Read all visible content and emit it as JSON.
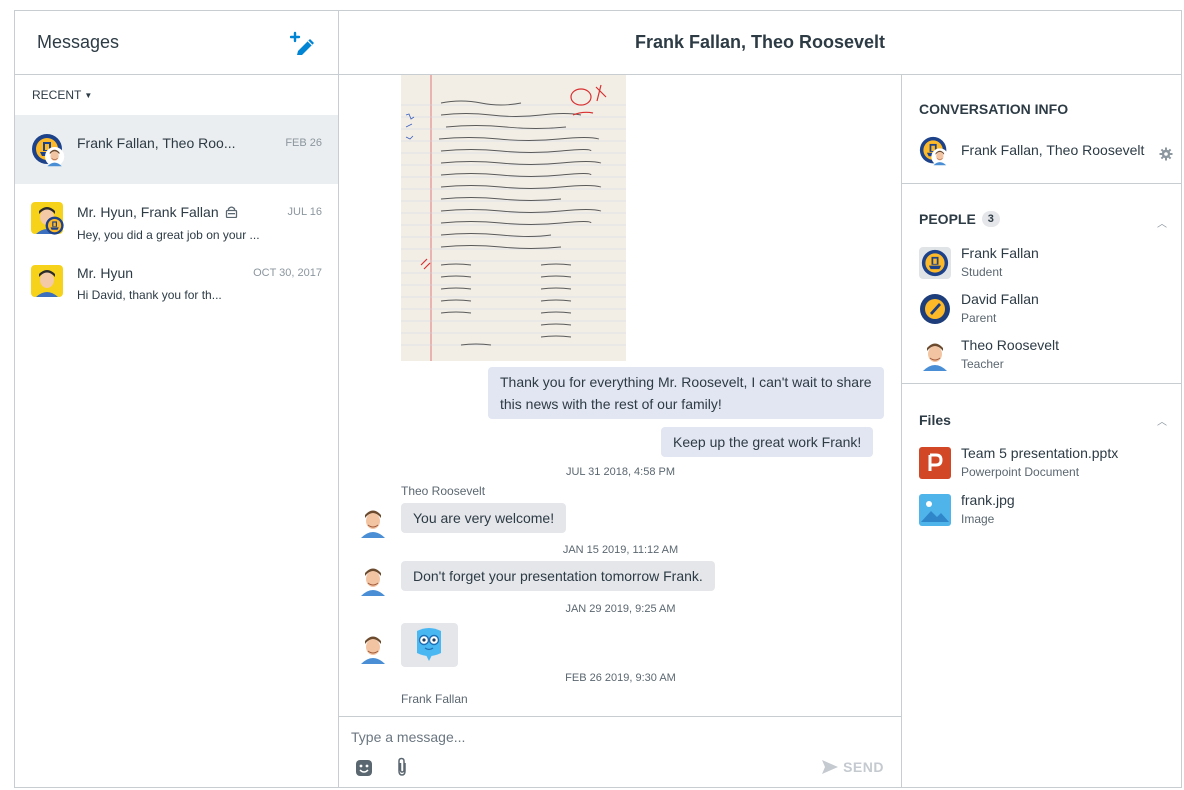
{
  "sidebar": {
    "title": "Messages",
    "filter_label": "RECENT",
    "conversations": [
      {
        "name": "Frank Fallan, Theo Roo...",
        "date": "FEB 26",
        "preview": ""
      },
      {
        "name": "Mr. Hyun, Frank Fallan",
        "date": "JUL 16",
        "preview": "Hey, you did a great job on your ..."
      },
      {
        "name": "Mr. Hyun",
        "date": "OCT 30, 2017",
        "preview": "Hi David, thank you for th..."
      }
    ]
  },
  "thread": {
    "title": "Frank Fallan, Theo Roosevelt",
    "messages": [
      {
        "text": "Thank you for everything Mr. Roosevelt, I can't wait to share this news with the rest of our family!"
      },
      {
        "text": "Keep up the great work Frank!"
      },
      {
        "stamp": "JUL 31 2018, 4:58 PM"
      },
      {
        "sender": "Theo Roosevelt",
        "text": "You are very welcome!"
      },
      {
        "stamp": "JAN 15 2019, 11:12 AM"
      },
      {
        "text": "Don't forget your presentation tomorrow Frank."
      },
      {
        "stamp": "JAN 29 2019, 9:25 AM"
      },
      {
        "stamp": "FEB 26 2019, 9:30 AM"
      },
      {
        "sender": "Frank Fallan"
      }
    ],
    "composer": {
      "placeholder": "Type a message...",
      "send_label": "SEND"
    }
  },
  "info": {
    "title": "CONVERSATION INFO",
    "conversation_name": "Frank Fallan, Theo Roosevelt",
    "people_title": "PEOPLE",
    "people_count": "3",
    "people": [
      {
        "name": "Frank Fallan",
        "role": "Student"
      },
      {
        "name": "David Fallan",
        "role": "Parent"
      },
      {
        "name": "Theo Roosevelt",
        "role": "Teacher"
      }
    ],
    "files_title": "Files",
    "files": [
      {
        "name": "Team 5 presentation.pptx",
        "type": "Powerpoint Document"
      },
      {
        "name": "frank.jpg",
        "type": "Image"
      }
    ]
  },
  "icons": [
    "compose-icon",
    "caret-down-icon",
    "lock-icon",
    "gear-icon",
    "chevron-up-icon",
    "emoji-icon",
    "paperclip-icon",
    "send-icon",
    "powerpoint-icon",
    "image-icon"
  ],
  "colors": {
    "accent": "#0084d4",
    "selected_bg": "#ebeef0",
    "bubble_out": "#e2e6f3",
    "bubble_in": "#e4e6ea",
    "powerpoint": "#d24726",
    "image": "#4fb4ea"
  }
}
